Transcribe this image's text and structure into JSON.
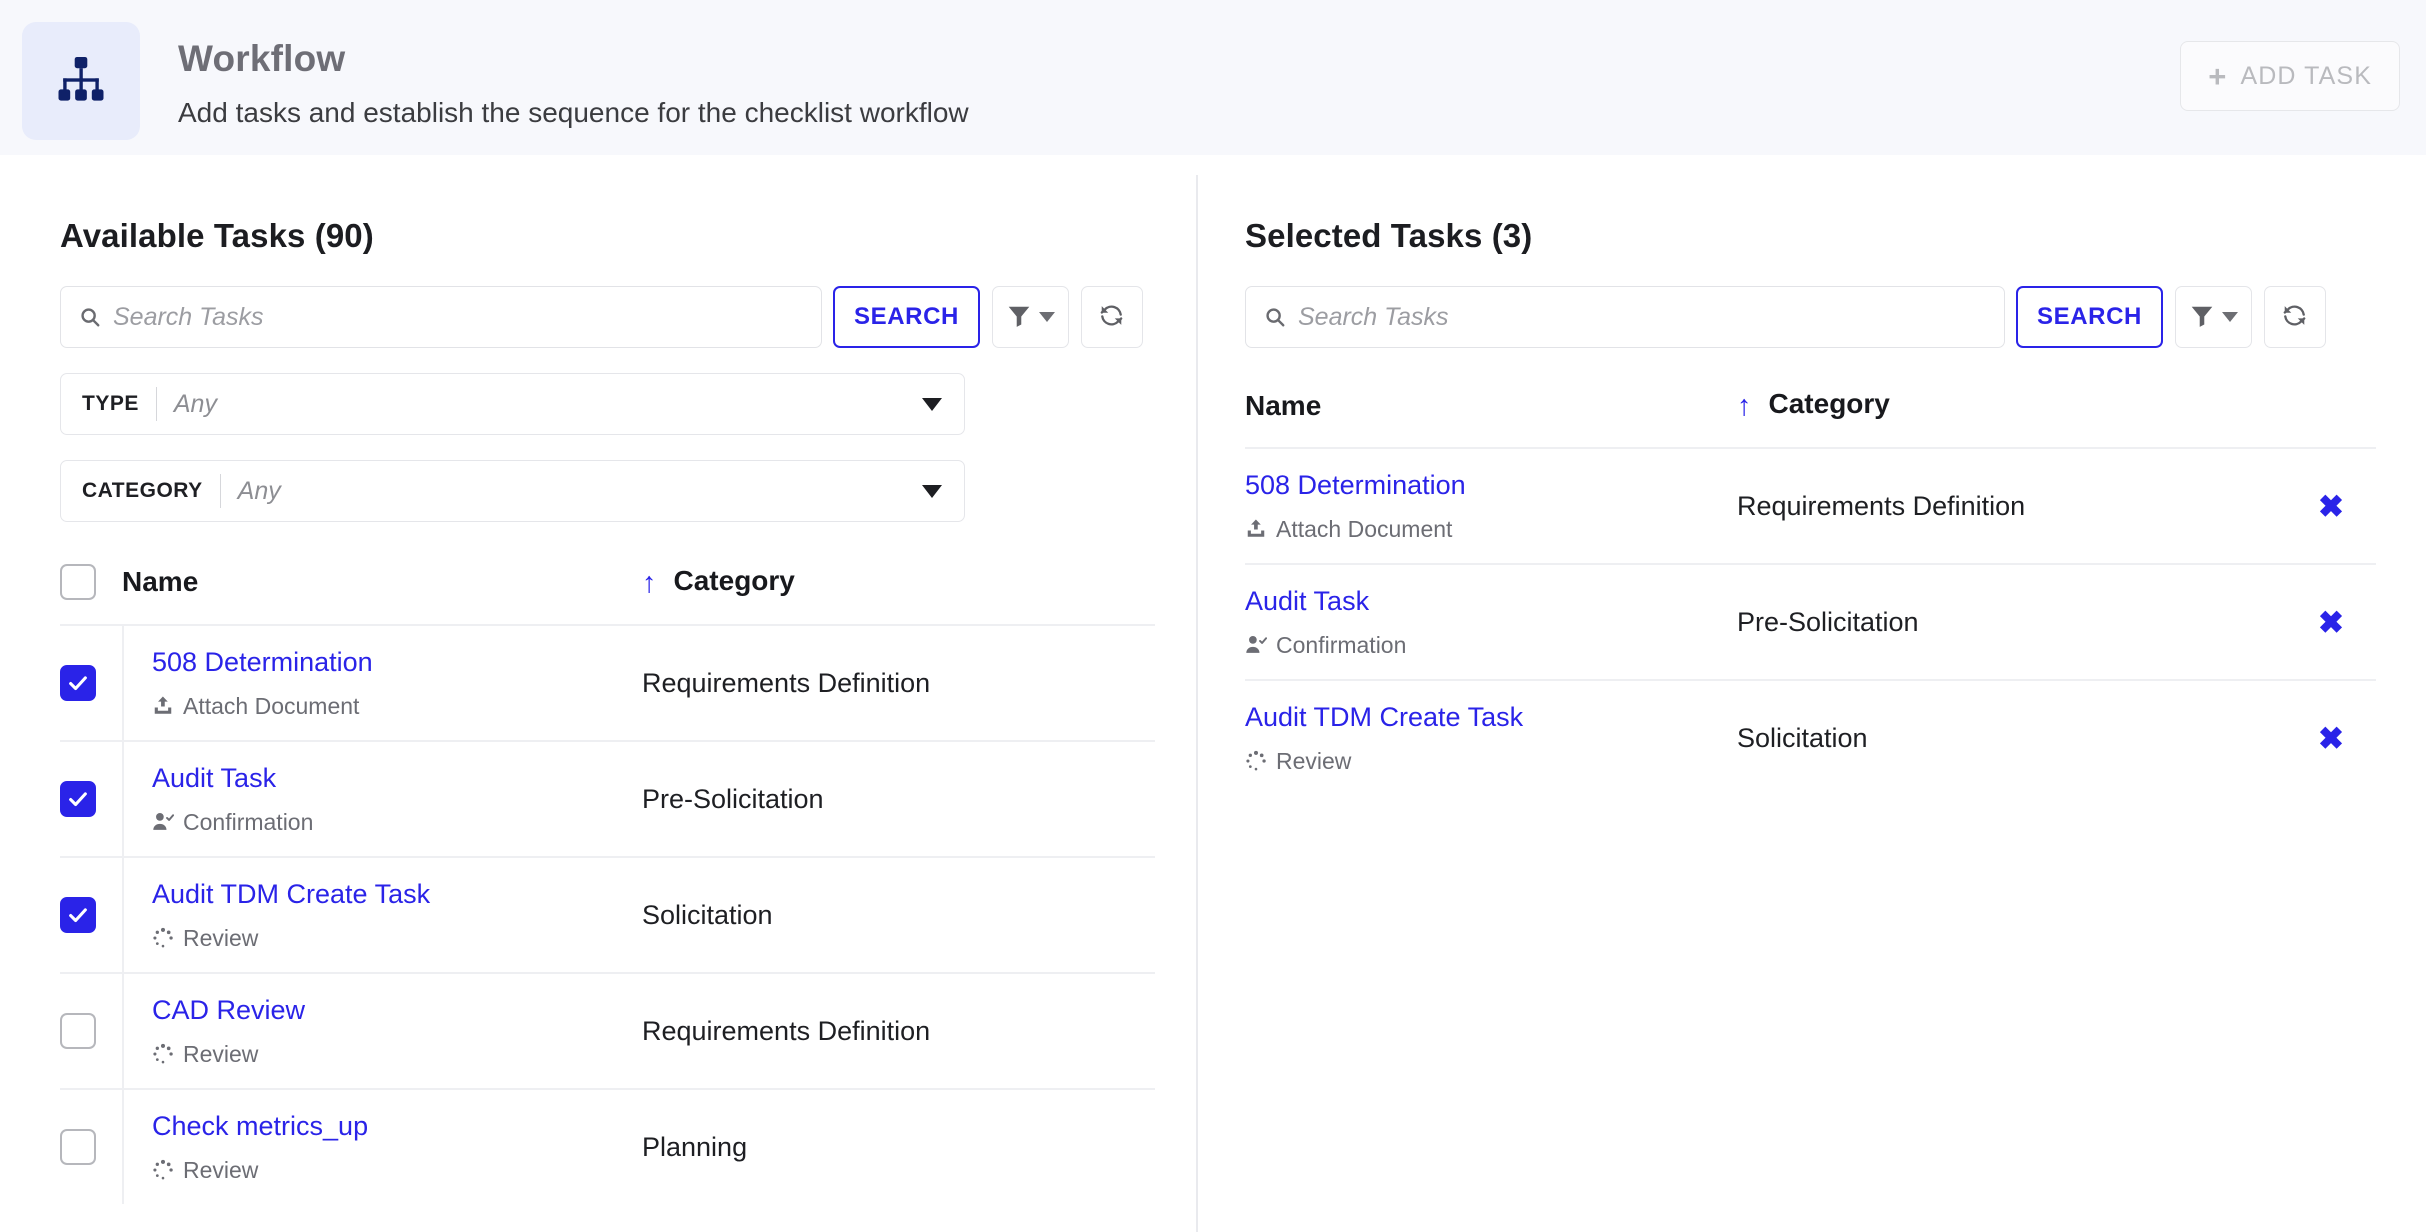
{
  "header": {
    "icon": "sitemap-icon",
    "title": "Workflow",
    "subtitle": "Add tasks and establish the sequence for the checklist workflow",
    "add_task_label": "ADD TASK",
    "add_task_plus": "+"
  },
  "available": {
    "title": "Available Tasks (90)",
    "search_placeholder": "Search Tasks",
    "search_value": "",
    "search_button": "SEARCH",
    "filter_icon": "funnel-icon",
    "refresh_icon": "refresh-icon",
    "filters": [
      {
        "label": "TYPE",
        "value": "Any"
      },
      {
        "label": "CATEGORY",
        "value": "Any"
      }
    ],
    "columns": {
      "name": "Name",
      "category": "Category"
    },
    "sort_indicator": "↑",
    "header_checkbox_checked": false,
    "rows": [
      {
        "name": "508 Determination",
        "type": "Attach Document",
        "type_icon": "upload-icon",
        "category": "Requirements Definition",
        "checked": true
      },
      {
        "name": "Audit Task",
        "type": "Confirmation",
        "type_icon": "user-check-icon",
        "category": "Pre-Solicitation",
        "checked": true
      },
      {
        "name": "Audit TDM Create Task",
        "type": "Review",
        "type_icon": "spinner-icon",
        "category": "Solicitation",
        "checked": true
      },
      {
        "name": "CAD Review",
        "type": "Review",
        "type_icon": "spinner-icon",
        "category": "Requirements Definition",
        "checked": false
      },
      {
        "name": "Check metrics_up",
        "type": "Review",
        "type_icon": "spinner-icon",
        "category": "Planning",
        "checked": false
      }
    ]
  },
  "selected": {
    "title": "Selected Tasks (3)",
    "search_placeholder": "Search Tasks",
    "search_value": "",
    "search_button": "SEARCH",
    "filter_icon": "funnel-icon",
    "refresh_icon": "refresh-icon",
    "columns": {
      "name": "Name",
      "category": "Category"
    },
    "sort_indicator": "↑",
    "remove_label": "✖",
    "rows": [
      {
        "name": "508 Determination",
        "type": "Attach Document",
        "type_icon": "upload-icon",
        "category": "Requirements Definition"
      },
      {
        "name": "Audit Task",
        "type": "Confirmation",
        "type_icon": "user-check-icon",
        "category": "Pre-Solicitation"
      },
      {
        "name": "Audit TDM Create Task",
        "type": "Review",
        "type_icon": "spinner-icon",
        "category": "Solicitation"
      }
    ]
  },
  "colors": {
    "accent": "#2a23e8",
    "icon_navy": "#0f2168",
    "icon_box_bg": "#e8ecfb",
    "header_bg": "#f7f8fc",
    "muted": "#6c6d74",
    "disabled": "#b9babe"
  }
}
